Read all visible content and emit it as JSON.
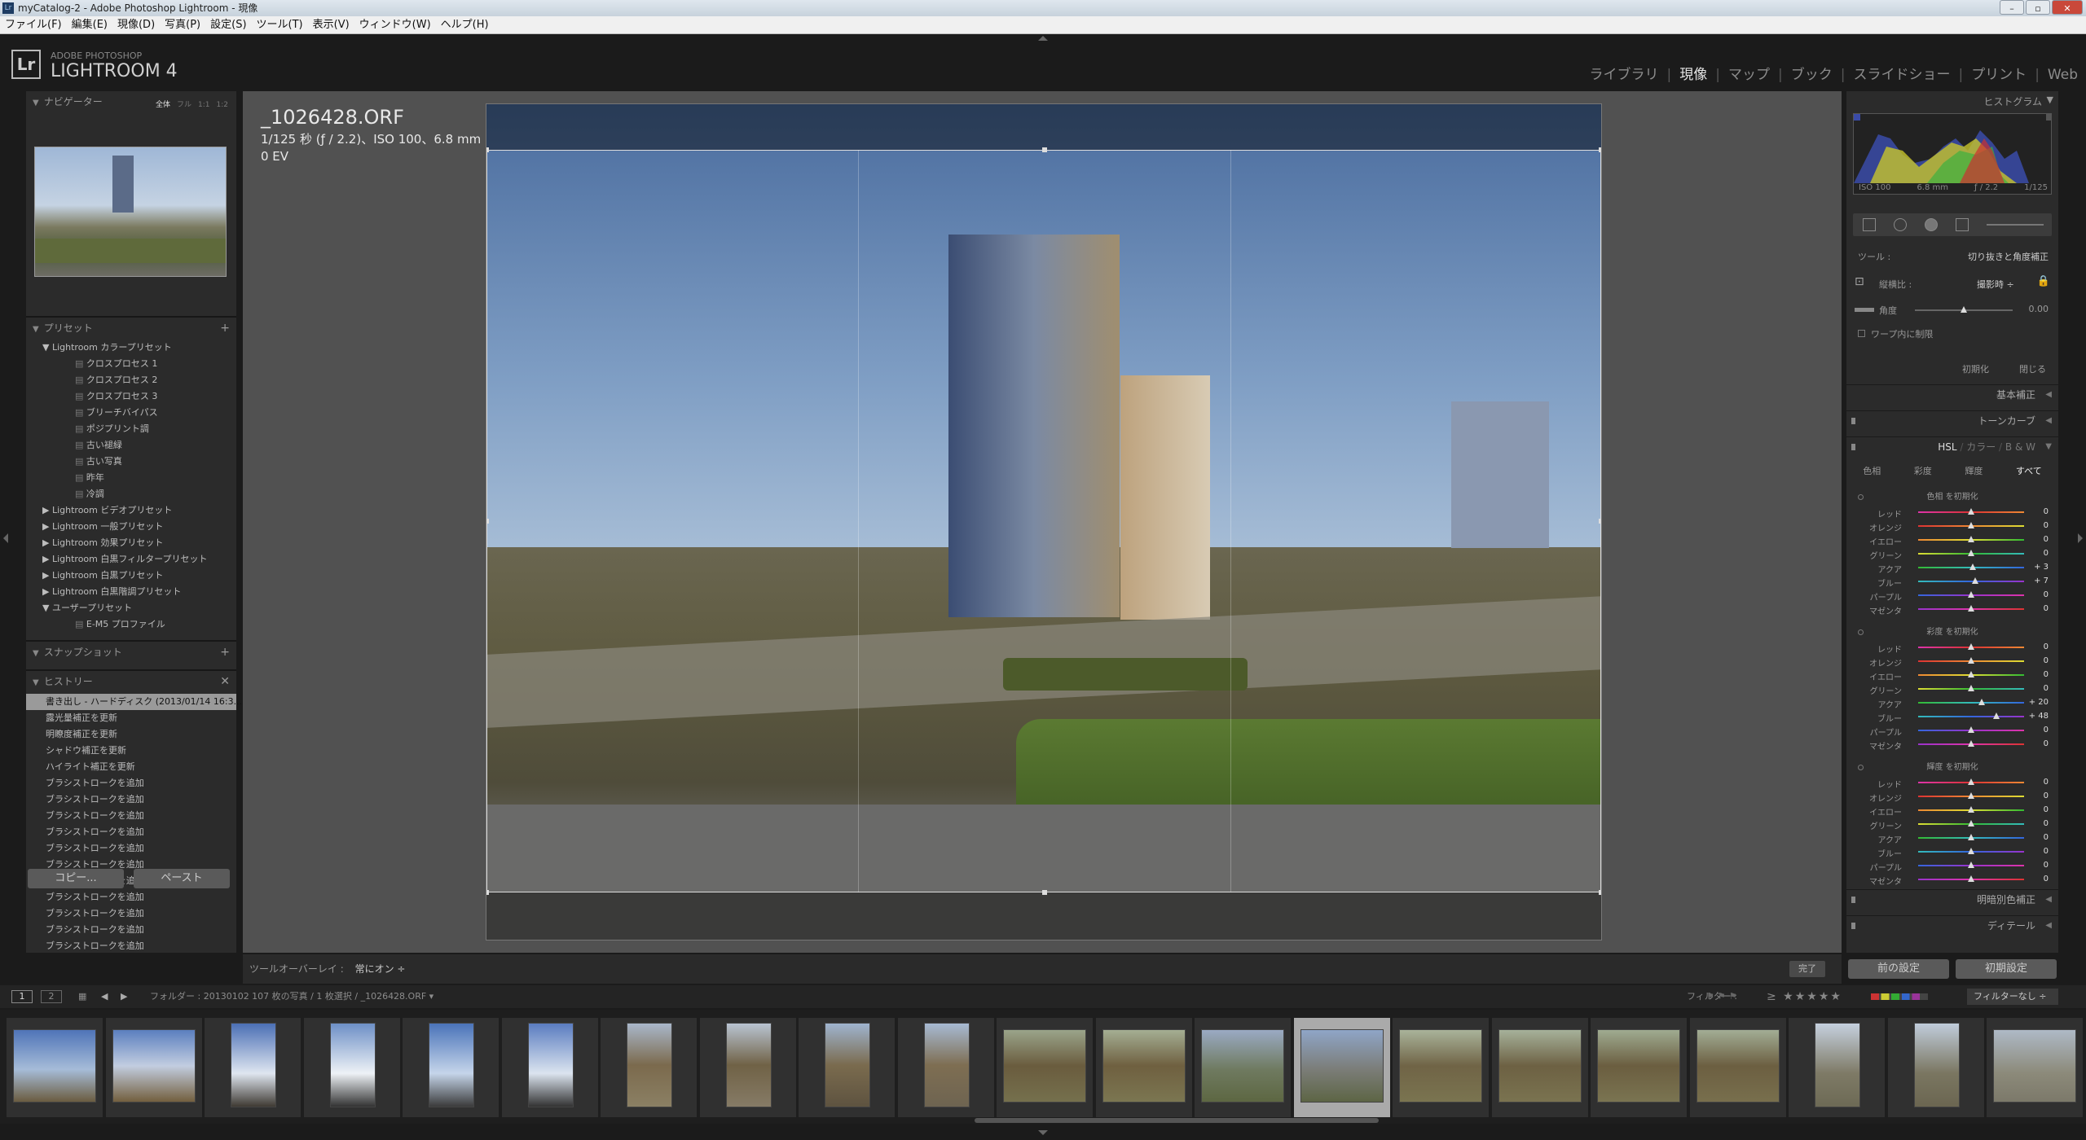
{
  "window": {
    "title": "myCatalog-2 - Adobe Photoshop Lightroom - 現像"
  },
  "menu": [
    "ファイル(F)",
    "編集(E)",
    "現像(D)",
    "写真(P)",
    "設定(S)",
    "ツール(T)",
    "表示(V)",
    "ウィンドウ(W)",
    "ヘルプ(H)"
  ],
  "identity": {
    "adobe": "ADOBE PHOTOSHOP",
    "product": "LIGHTROOM 4",
    "logo": "Lr"
  },
  "modules": [
    {
      "label": "ライブラリ",
      "active": false
    },
    {
      "label": "現像",
      "active": true
    },
    {
      "label": "マップ",
      "active": false
    },
    {
      "label": "ブック",
      "active": false
    },
    {
      "label": "スライドショー",
      "active": false
    },
    {
      "label": "プリント",
      "active": false
    },
    {
      "label": "Web",
      "active": false
    }
  ],
  "navigator": {
    "title": "ナビゲーター",
    "modes": [
      "全体",
      "フル",
      "1:1",
      "1:2"
    ]
  },
  "presets": {
    "title": "プリセット",
    "items": [
      {
        "label": "▼ Lightroom カラープリセット",
        "indent": 1
      },
      {
        "label": "クロスプロセス 1",
        "indent": 2
      },
      {
        "label": "クロスプロセス 2",
        "indent": 2
      },
      {
        "label": "クロスプロセス 3",
        "indent": 2
      },
      {
        "label": "ブリーチバイパス",
        "indent": 2
      },
      {
        "label": "ポジプリント調",
        "indent": 2
      },
      {
        "label": "古い褪緑",
        "indent": 2
      },
      {
        "label": "古い写真",
        "indent": 2
      },
      {
        "label": "昨年",
        "indent": 2
      },
      {
        "label": "冷調",
        "indent": 2
      },
      {
        "label": "▶ Lightroom ビデオプリセット",
        "indent": 1
      },
      {
        "label": "▶ Lightroom 一般プリセット",
        "indent": 1
      },
      {
        "label": "▶ Lightroom 効果プリセット",
        "indent": 1
      },
      {
        "label": "▶ Lightroom 白黒フィルタープリセット",
        "indent": 1
      },
      {
        "label": "▶ Lightroom 白黒プリセット",
        "indent": 1
      },
      {
        "label": "▶ Lightroom 白黒階調プリセット",
        "indent": 1
      },
      {
        "label": "▼ ユーザープリセット",
        "indent": 1
      },
      {
        "label": "E-M5 プロファイル",
        "indent": 2
      }
    ]
  },
  "snapshot": {
    "title": "スナップショット"
  },
  "history": {
    "title": "ヒストリー",
    "items": [
      "書き出し - ハードディスク (2013/01/14 16:3...",
      "露光量補正を更新",
      "明瞭度補正を更新",
      "シャドウ補正を更新",
      "ハイライト補正を更新",
      "ブラシストロークを追加",
      "ブラシストロークを追加",
      "ブラシストロークを追加",
      "ブラシストロークを追加",
      "ブラシストロークを追加",
      "ブラシストロークを追加",
      "ブラシストロークを追加",
      "ブラシストロークを追加",
      "ブラシストロークを追加",
      "ブラシストロークを追加",
      "ブラシストロークを追加"
    ]
  },
  "leftButtons": {
    "copy": "コピー...",
    "paste": "ペースト"
  },
  "photoInfo": {
    "filename": "_1026428.ORF",
    "exposure": "1/125 秒 (ƒ / 2.2)、ISO 100、6.8 mm",
    "ev": "0 EV"
  },
  "toolbar": {
    "overlayLabel": "ツールオーバーレイ :",
    "overlayValue": "常にオン ÷",
    "done": "完了"
  },
  "rightButtons": {
    "prev": "前の設定",
    "reset": "初期設定"
  },
  "histogram": {
    "title": "ヒストグラム",
    "iso": "ISO 100",
    "focal": "6.8 mm",
    "aperture": "ƒ / 2.2",
    "shutter": "1/125"
  },
  "crop": {
    "toolLabel": "ツール :",
    "toolValue": "切り抜きと角度補正",
    "aspectLabel": "縦横比 :",
    "aspectValue": "撮影時 ÷",
    "angleLabel": "角度",
    "angleValue": "0.00",
    "warpLabel": "ワープ内に制限",
    "resetLabel": "初期化",
    "closeLabel": "閉じる"
  },
  "sections": {
    "basic": "基本補正",
    "tone": "トーンカーブ",
    "hslTabs": [
      "HSL",
      "カラー",
      "B & W"
    ],
    "hslSub": [
      "色相",
      "彩度",
      "輝度",
      "すべて"
    ],
    "split": "明暗別色補正",
    "detail": "ディテール"
  },
  "hsl": {
    "groups": [
      {
        "title": "色相 を初期化",
        "rows": [
          [
            "レッド",
            "0"
          ],
          [
            "オレンジ",
            "0"
          ],
          [
            "イエロー",
            "0"
          ],
          [
            "グリーン",
            "0"
          ],
          [
            "アクア",
            "+ 3"
          ],
          [
            "ブルー",
            "+ 7"
          ],
          [
            "パープル",
            "0"
          ],
          [
            "マゼンタ",
            "0"
          ]
        ]
      },
      {
        "title": "彩度 を初期化",
        "rows": [
          [
            "レッド",
            "0"
          ],
          [
            "オレンジ",
            "0"
          ],
          [
            "イエロー",
            "0"
          ],
          [
            "グリーン",
            "0"
          ],
          [
            "アクア",
            "+ 20"
          ],
          [
            "ブルー",
            "+ 48"
          ],
          [
            "パープル",
            "0"
          ],
          [
            "マゼンタ",
            "0"
          ]
        ]
      },
      {
        "title": "輝度 を初期化",
        "rows": [
          [
            "レッド",
            "0"
          ],
          [
            "オレンジ",
            "0"
          ],
          [
            "イエロー",
            "0"
          ],
          [
            "グリーン",
            "0"
          ],
          [
            "アクア",
            "0"
          ],
          [
            "ブルー",
            "0"
          ],
          [
            "パープル",
            "0"
          ],
          [
            "マゼンタ",
            "0"
          ]
        ]
      }
    ]
  },
  "filmstripBar": {
    "page1": "1",
    "page2": "2",
    "source": "フォルダー : 20130102   107 枚の写真 / 1 枚選択 / _1026428.ORF ▾",
    "filterLabel": "フィルター :",
    "stars": "≥ ★★★★★",
    "filterValue": "フィルターなし ÷"
  }
}
